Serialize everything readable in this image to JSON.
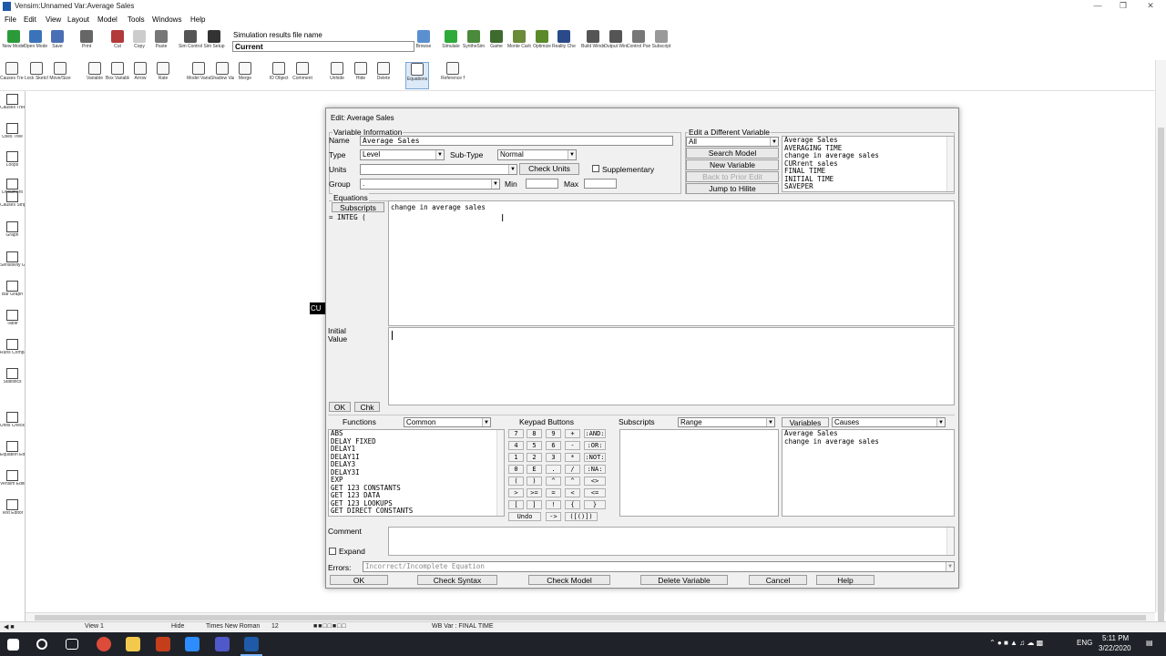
{
  "window": {
    "title": "Vensim:Unnamed Var:Average Sales"
  },
  "menu": [
    "File",
    "Edit",
    "View",
    "Layout",
    "Model",
    "Tools",
    "Windows",
    "Help"
  ],
  "toolbar1": {
    "buttons": [
      {
        "label": "New Model",
        "icon": "new-model-icon",
        "color": "#2b9b3a"
      },
      {
        "label": "Open Model",
        "icon": "open-model-icon",
        "color": "#3b73b9"
      },
      {
        "label": "Save",
        "icon": "save-icon",
        "color": "#4a6fb5"
      },
      {
        "label": "Print",
        "icon": "print-icon",
        "color": "#666666"
      },
      {
        "label": "Cut",
        "icon": "cut-icon",
        "color": "#b33a3a"
      },
      {
        "label": "Copy",
        "icon": "copy-icon",
        "color": "#cccccc"
      },
      {
        "label": "Paste",
        "icon": "paste-icon",
        "color": "#777777"
      },
      {
        "label": "Sim Control",
        "icon": "sim-control-icon",
        "color": "#555555"
      },
      {
        "label": "Sim Setup",
        "icon": "sim-setup-icon",
        "color": "#333333"
      }
    ],
    "results_label": "Simulation results file name",
    "results_value": "Current",
    "buttons2": [
      {
        "label": "Browse",
        "icon": "browse-icon",
        "color": "#5a8fd0"
      },
      {
        "label": "Simulate",
        "icon": "simulate-icon",
        "color": "#2eaa3a"
      },
      {
        "label": "SyntheSim",
        "icon": "synthesim-icon",
        "color": "#4a8a3a"
      },
      {
        "label": "Game",
        "icon": "game-icon",
        "color": "#3d6b2d"
      },
      {
        "label": "Monte Carlo",
        "icon": "monte-carlo-icon",
        "color": "#6b8a3a"
      },
      {
        "label": "Optimize",
        "icon": "optimize-icon",
        "color": "#5a8a2a"
      },
      {
        "label": "Reality Checks",
        "icon": "reality-checks-icon",
        "color": "#2a4a8a"
      },
      {
        "label": "Build Windows",
        "icon": "build-windows-icon",
        "color": "#555555"
      },
      {
        "label": "Output Windows",
        "icon": "output-windows-icon",
        "color": "#555555"
      },
      {
        "label": "Control Panel",
        "icon": "control-panel-icon",
        "color": "#777777"
      },
      {
        "label": "Subscript",
        "icon": "subscript-icon",
        "color": "#999999"
      }
    ]
  },
  "toolbar2": {
    "buttons": [
      {
        "label": "Causes Tree",
        "icon": "causes-tree-icon"
      },
      {
        "label": "Lock Sketch",
        "icon": "lock-icon"
      },
      {
        "label": "Move/Size",
        "icon": "move-size-icon"
      },
      {
        "label": "Variable",
        "icon": "variable-icon"
      },
      {
        "label": "Box Variable",
        "icon": "box-variable-icon"
      },
      {
        "label": "Arrow",
        "icon": "arrow-icon"
      },
      {
        "label": "Rate",
        "icon": "rate-icon"
      },
      {
        "label": "Model Variable",
        "icon": "model-variable-icon"
      },
      {
        "label": "Shadow Variable",
        "icon": "shadow-variable-icon"
      },
      {
        "label": "Merge",
        "icon": "merge-icon"
      },
      {
        "label": "IO Object",
        "icon": "io-object-icon"
      },
      {
        "label": "Comment",
        "icon": "comment-icon"
      },
      {
        "label": "Unhide",
        "icon": "unhide-icon"
      },
      {
        "label": "Hide",
        "icon": "hide-icon"
      },
      {
        "label": "Delete",
        "icon": "delete-icon"
      },
      {
        "label": "Equations",
        "icon": "equations-icon"
      },
      {
        "label": "Reference Mode",
        "icon": "reference-mode-icon"
      }
    ]
  },
  "palette": [
    {
      "label": "Causes Tree",
      "icon": "causes-tree-icon"
    },
    {
      "label": "Uses Tree",
      "icon": "uses-tree-icon"
    },
    {
      "label": "Loops",
      "icon": "loops-icon"
    },
    {
      "label": "Document",
      "icon": "document-icon"
    },
    {
      "label": "Causes Strip",
      "icon": "causes-strip-icon"
    },
    {
      "label": "Graph",
      "icon": "graph-icon"
    },
    {
      "label": "Sensitivity Graph",
      "icon": "sensitivity-graph-icon"
    },
    {
      "label": "Bar Graph",
      "icon": "bar-graph-icon"
    },
    {
      "label": "Table",
      "icon": "table-icon"
    },
    {
      "label": "Runs Compare",
      "icon": "runs-compare-icon"
    },
    {
      "label": "Statistics",
      "icon": "statistics-icon"
    },
    {
      "label": "Units Check",
      "icon": "units-check-icon"
    },
    {
      "label": "Equation Editor",
      "icon": "equation-editor-icon"
    },
    {
      "label": "Vensim Editor",
      "icon": "vensim-editor-icon"
    },
    {
      "label": "Text Editor",
      "icon": "text-editor-icon"
    }
  ],
  "canvas": {
    "clipped_label": "CU"
  },
  "dialog": {
    "title": "Edit: Average Sales",
    "variable_info_label": "Variable Information",
    "name_label": "Name",
    "name_value": "Average Sales",
    "type_label": "Type",
    "type_value": "Level",
    "subtype_label": "Sub-Type",
    "subtype_value": "Normal",
    "units_label": "Units",
    "units_value": "",
    "check_units": "Check Units",
    "supplementary": "Supplementary",
    "group_label": "Group",
    "group_value": ".",
    "min_label": "Min",
    "max_label": "Max",
    "edit_different_label": "Edit a Different Variable",
    "filter_value": "All",
    "search_model": "Search Model",
    "new_variable": "New Variable",
    "back_to_prior": "Back to Prior Edit",
    "jump_to_hilite": "Jump to Hilite",
    "var_list": [
      "Average Sales",
      "AVERAGING TIME",
      "change in average sales",
      "CURrent sales",
      "FINAL TIME",
      "INITIAL TIME",
      "SAVEPER"
    ],
    "equations_label": "Equations",
    "subscripts_btn": "Subscripts",
    "integ_label": "= INTEG (",
    "equation_text": "change in average sales",
    "initial_value_label": "Initial Value",
    "ok_small": "OK",
    "chk_small": "Chk",
    "functions_label": "Functions",
    "functions_filter": "Common",
    "functions": [
      "ABS",
      "DELAY FIXED",
      "DELAY1",
      "DELAY1I",
      "DELAY3",
      "DELAY3I",
      "EXP",
      "GET 123 CONSTANTS",
      "GET 123 DATA",
      "GET 123 LOOKUPS",
      "GET DIRECT CONSTANTS"
    ],
    "keypad_label": "Keypad Buttons",
    "keypad": [
      [
        "7",
        "8",
        "9",
        "+",
        ":AND:"
      ],
      [
        "4",
        "5",
        "6",
        "-",
        ":OR:"
      ],
      [
        "1",
        "2",
        "3",
        "*",
        ":NOT:"
      ],
      [
        "0",
        "E",
        ".",
        "/",
        ":NA:"
      ],
      [
        "(",
        ")",
        "^",
        "^",
        "<>"
      ],
      [
        ">",
        ">=",
        "=",
        "<",
        "<="
      ],
      [
        "[",
        "]",
        "!",
        "{",
        "}"
      ]
    ],
    "undo": "Undo",
    "arrow_key": "->",
    "brackets_key": "([()])",
    "subscripts_label": "Subscripts",
    "subscripts_filter": "Range",
    "variables_label": "Variables",
    "variables_filter": "Causes",
    "variables": [
      "Average Sales",
      "change in average sales"
    ],
    "comment_label": "Comment",
    "expand_label": "Expand",
    "errors_label": "Errors:",
    "errors_value": "Incorrect/Incomplete Equation",
    "buttons": [
      "OK",
      "Check Syntax",
      "Check Model",
      "Delete Variable",
      "Cancel",
      "Help"
    ]
  },
  "status": {
    "view": "View 1",
    "hide": "Hide",
    "font": "Times New Roman",
    "size": "12",
    "var": "WB Var : FINAL TIME"
  },
  "taskbar": {
    "lang": "ENG",
    "time": "5:11 PM",
    "date": "3/22/2020"
  }
}
